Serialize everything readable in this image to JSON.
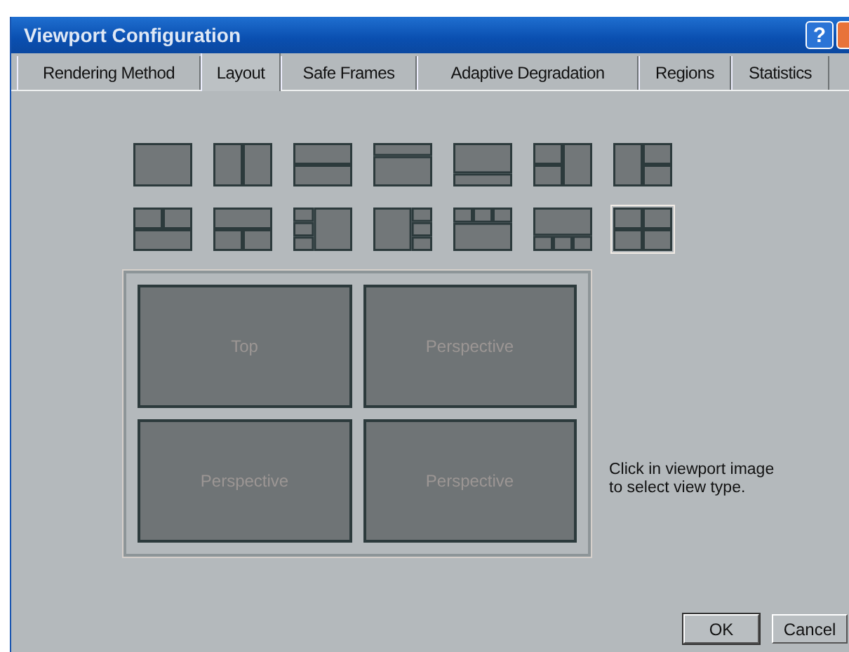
{
  "window": {
    "title": "Viewport Configuration",
    "help_button": "?"
  },
  "tabs": [
    {
      "label": "Rendering Method",
      "selected": false
    },
    {
      "label": "Layout",
      "selected": true
    },
    {
      "label": "Safe Frames",
      "selected": false
    },
    {
      "label": "Adaptive Degradation",
      "selected": false
    },
    {
      "label": "Regions",
      "selected": false
    },
    {
      "label": "Statistics",
      "selected": false
    }
  ],
  "layouts": [
    {
      "kind": "single",
      "selected": false
    },
    {
      "kind": "two-columns",
      "selected": false
    },
    {
      "kind": "two-rows",
      "selected": false
    },
    {
      "kind": "top-small",
      "selected": false
    },
    {
      "kind": "bottom-small",
      "selected": false
    },
    {
      "kind": "left-split",
      "selected": false
    },
    {
      "kind": "right-split",
      "selected": false
    },
    {
      "kind": "top-split",
      "selected": false
    },
    {
      "kind": "bottom-split",
      "selected": false
    },
    {
      "kind": "left-three",
      "selected": false
    },
    {
      "kind": "right-three",
      "selected": false
    },
    {
      "kind": "top-three",
      "selected": false
    },
    {
      "kind": "bottom-three",
      "selected": false
    },
    {
      "kind": "quad",
      "selected": true
    }
  ],
  "viewports": [
    {
      "label": "Top"
    },
    {
      "label": "Perspective"
    },
    {
      "label": "Perspective"
    },
    {
      "label": "Perspective"
    }
  ],
  "hint": "Click in viewport image to select view type.",
  "buttons": [
    "OK",
    "Cancel"
  ]
}
